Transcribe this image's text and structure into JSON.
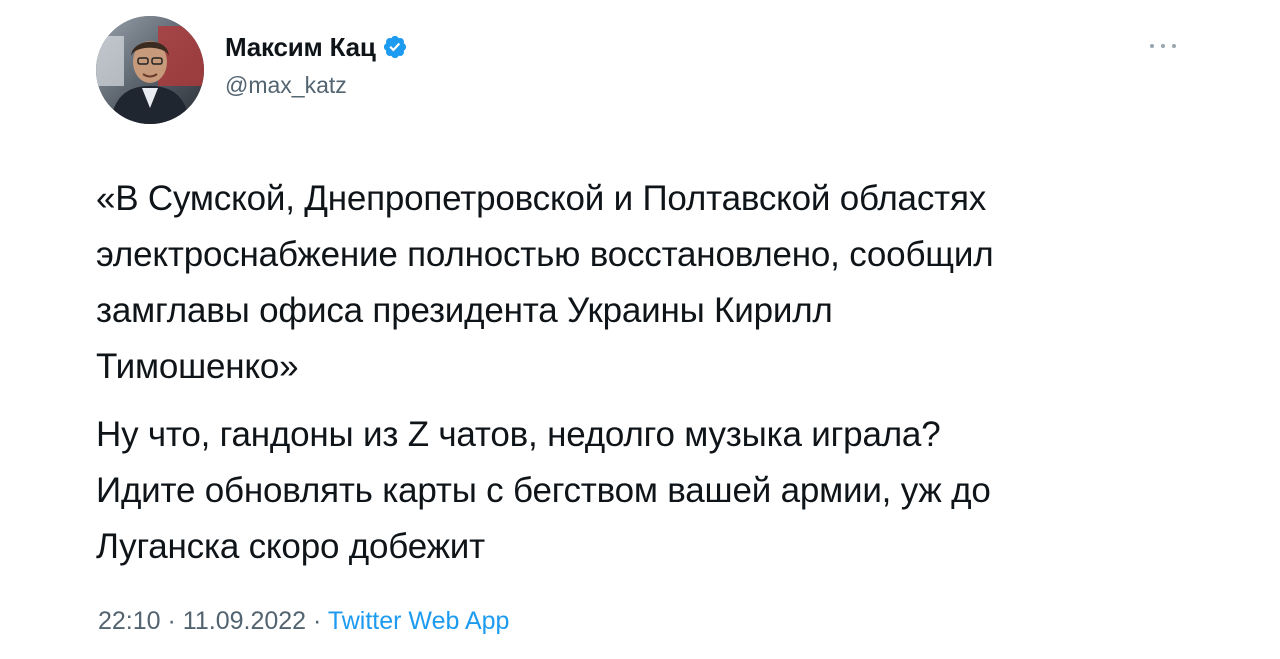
{
  "author": {
    "display_name": "Максим Кац",
    "handle": "@max_katz",
    "verified": true,
    "avatar_icon": "profile-photo"
  },
  "menu": {
    "icon": "more-horizontal-icon"
  },
  "tweet": {
    "paragraphs": [
      "«В Сумской, Днепропетровской и Полтавской областях\nэлектроснабжение полностью восстановлено, сообщил\nзамглавы офиса президента Украины Кирилл\nТимошенко»",
      "Ну что, гандоны из Z чатов, недолго музыка играла?\nИдите обновлять карты с бегством вашей армии, уж до\nЛуганска скоро добежит"
    ]
  },
  "meta": {
    "time": "22:10",
    "separator": "·",
    "date": "11.09.2022",
    "source": "Twitter Web App"
  },
  "colors": {
    "text": "#0f1419",
    "secondary": "#536471",
    "accent": "#1d9bf0"
  }
}
